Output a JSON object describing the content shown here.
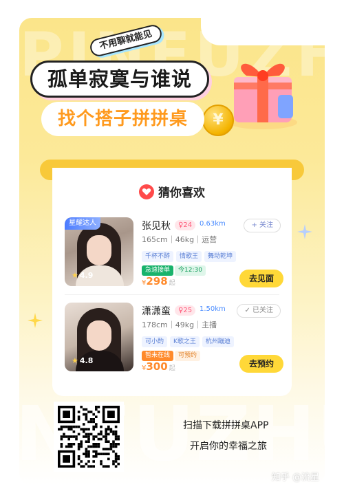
{
  "background_words": {
    "top": "PINFUZHUO",
    "bottom": "NFUZHU"
  },
  "header": {
    "tag_pill": "不用聊就能见",
    "headline_1": "孤单寂寞与谁说",
    "headline_2": "找个搭子拼拼桌",
    "coin_symbol": "¥"
  },
  "card": {
    "title": "猜你喜欢",
    "icon": "heart-icon",
    "users": [
      {
        "badge": "星耀达人",
        "rating": "4.9",
        "name": "张见秋",
        "age": "24",
        "distance": "0.63km",
        "stats": "165cm｜46kg｜运营",
        "tags": [
          "千杯不醉",
          "情歌王",
          "舞动乾坤"
        ],
        "status_primary": "急速接单",
        "status_secondary": "今12:30",
        "price_symbol": "¥",
        "price": "298",
        "price_unit": "起",
        "follow_label": "+ 关注",
        "action_label": "去见面"
      },
      {
        "badge": "",
        "rating": "4.8",
        "name": "潇潇蛮",
        "age": "25",
        "distance": "1.50km",
        "stats": "178cm｜49kg｜主播",
        "tags": [
          "可小酌",
          "K歌之王",
          "杭州蹦迪"
        ],
        "status_primary": "暂未在线",
        "status_secondary": "可预约",
        "price_symbol": "¥",
        "price": "300",
        "price_unit": "起",
        "follow_label": "✓ 已关注",
        "action_label": "去预约"
      }
    ]
  },
  "footer": {
    "cta_line_1": "扫描下载拼拼桌APP",
    "cta_line_2": "开启你的幸福之旅",
    "credit": "知乎 @流星"
  },
  "colors": {
    "accent_yellow": "#ffd838",
    "orange": "#ff9a1e",
    "heart_red": "#ff4a4a"
  }
}
